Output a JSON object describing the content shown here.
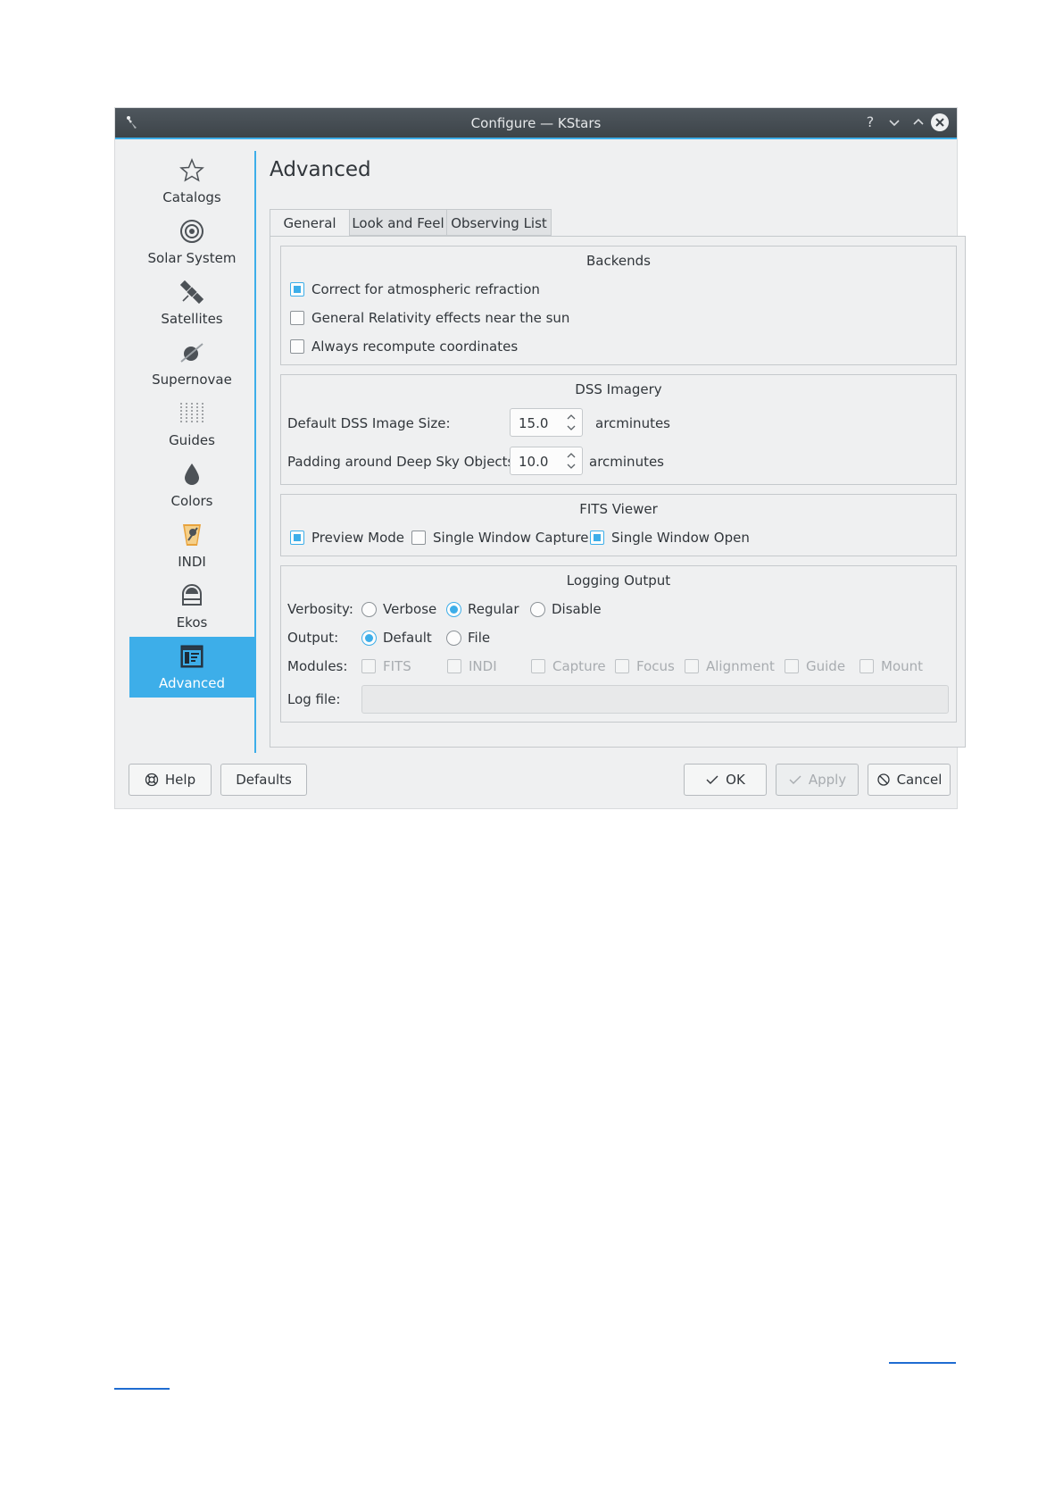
{
  "window": {
    "title": "Configure — KStars",
    "controls": {
      "help": "?",
      "minimize": "⌄",
      "maximize": "⌃",
      "close": "✕"
    }
  },
  "sidebar": {
    "items": [
      {
        "label": "Catalogs",
        "icon": "star-icon"
      },
      {
        "label": "Solar System",
        "icon": "solar-system-icon"
      },
      {
        "label": "Satellites",
        "icon": "satellite-icon"
      },
      {
        "label": "Supernovae",
        "icon": "supernova-icon"
      },
      {
        "label": "Guides",
        "icon": "guides-icon"
      },
      {
        "label": "Colors",
        "icon": "color-drop-icon"
      },
      {
        "label": "INDI",
        "icon": "indi-icon"
      },
      {
        "label": "Ekos",
        "icon": "ekos-icon"
      },
      {
        "label": "Advanced",
        "icon": "advanced-icon",
        "active": true
      }
    ]
  },
  "page_title": "Advanced",
  "tabs": [
    "General",
    "Look and Feel",
    "Observing List"
  ],
  "backends": {
    "title": "Backends",
    "options": [
      {
        "label": "Correct for atmospheric refraction",
        "checked": true
      },
      {
        "label": "General Relativity effects near the sun",
        "checked": false
      },
      {
        "label": "Always recompute coordinates",
        "checked": false
      }
    ]
  },
  "dss": {
    "title": "DSS Imagery",
    "image_size_label": "Default DSS Image Size:",
    "image_size_value": "15.0",
    "image_size_unit": "arcminutes",
    "padding_label": "Padding around Deep Sky Objects:",
    "padding_value": "10.0",
    "padding_unit": "arcminutes"
  },
  "fits": {
    "title": "FITS Viewer",
    "options": [
      {
        "label": "Preview Mode",
        "checked": true
      },
      {
        "label": "Single Window Capture",
        "checked": false
      },
      {
        "label": "Single Window Open",
        "checked": true
      }
    ]
  },
  "logging": {
    "title": "Logging Output",
    "verbosity_label": "Verbosity:",
    "verbosity_options": [
      "Verbose",
      "Regular",
      "Disable"
    ],
    "verbosity_selected": "Regular",
    "output_label": "Output:",
    "output_options": [
      "Default",
      "File"
    ],
    "output_selected": "Default",
    "modules_label": "Modules:",
    "modules": [
      "FITS",
      "INDI",
      "Capture",
      "Focus",
      "Alignment",
      "Guide",
      "Mount"
    ],
    "logfile_label": "Log file:",
    "logfile_value": ""
  },
  "buttons": {
    "help": "Help",
    "defaults": "Defaults",
    "ok": "OK",
    "apply": "Apply",
    "cancel": "Cancel"
  },
  "colors": {
    "accent": "#3daee9",
    "titlebar": "#475057",
    "background": "#eff0f1"
  }
}
